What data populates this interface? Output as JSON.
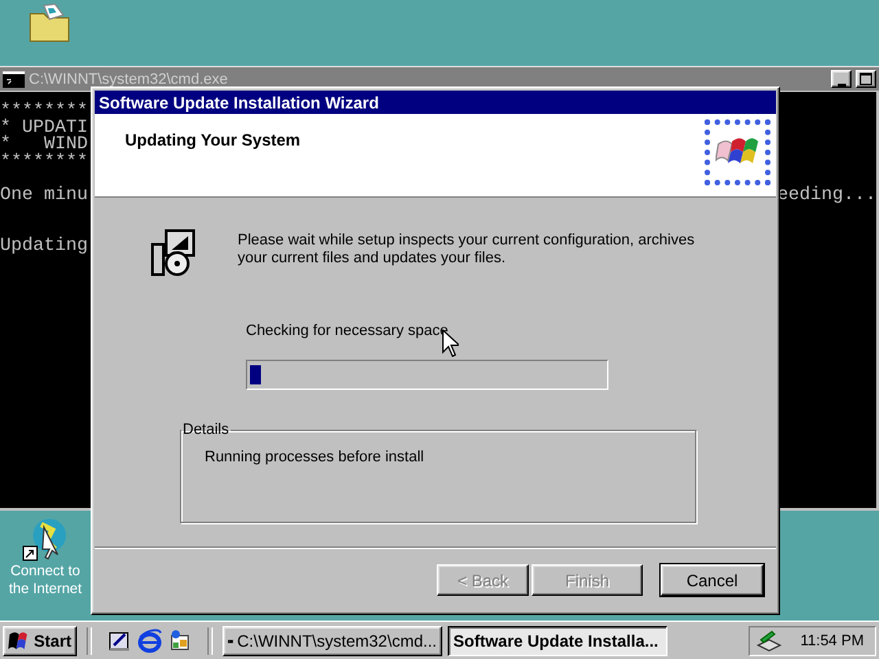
{
  "desktop_icons": [
    {
      "kind": "folder"
    },
    {
      "kind": "globe",
      "label": "Connect to the Internet"
    }
  ],
  "console": {
    "title": "C:\\WINNT\\system32\\cmd.exe",
    "active": false,
    "lines": [
      {
        "kind": "text",
        "left": "********"
      },
      {
        "kind": "text",
        "left": "* UPDATI"
      },
      {
        "kind": "text",
        "left": "*   WIND"
      },
      {
        "kind": "text",
        "left": "********"
      },
      {
        "kind": "blank"
      },
      {
        "kind": "text",
        "left": "One minu",
        "right": "eeding..."
      },
      {
        "kind": "blank"
      },
      {
        "kind": "blank"
      },
      {
        "kind": "text",
        "left": "Updating"
      }
    ]
  },
  "wizard": {
    "title": "Software Update Installation Wizard",
    "active": true,
    "heading": "Updating Your System",
    "message": "Please wait while setup inspects your current configuration, archives your current files and updates your files.",
    "status": "Checking for necessary space",
    "progress": {
      "level": 0.03
    },
    "details": {
      "label": "Details",
      "text": "Running processes before install"
    },
    "buttons": [
      {
        "label": "< Back",
        "disabled": true,
        "default": false
      },
      {
        "label": "Finish",
        "disabled": true,
        "default": false
      },
      {
        "label": "Cancel",
        "disabled": false,
        "default": true
      }
    ]
  },
  "taskbar": {
    "start": "Start",
    "quick_launch": [
      {
        "kind": "desktop"
      },
      {
        "kind": "browser"
      },
      {
        "kind": "channels"
      }
    ],
    "tasks": [
      {
        "kind": "console",
        "label": "C:\\WINNT\\system32\\cmd...",
        "selected": false
      },
      {
        "kind": "wizard",
        "label": "Software Update Installa...",
        "selected": true
      }
    ],
    "clock": "11:54 PM"
  }
}
